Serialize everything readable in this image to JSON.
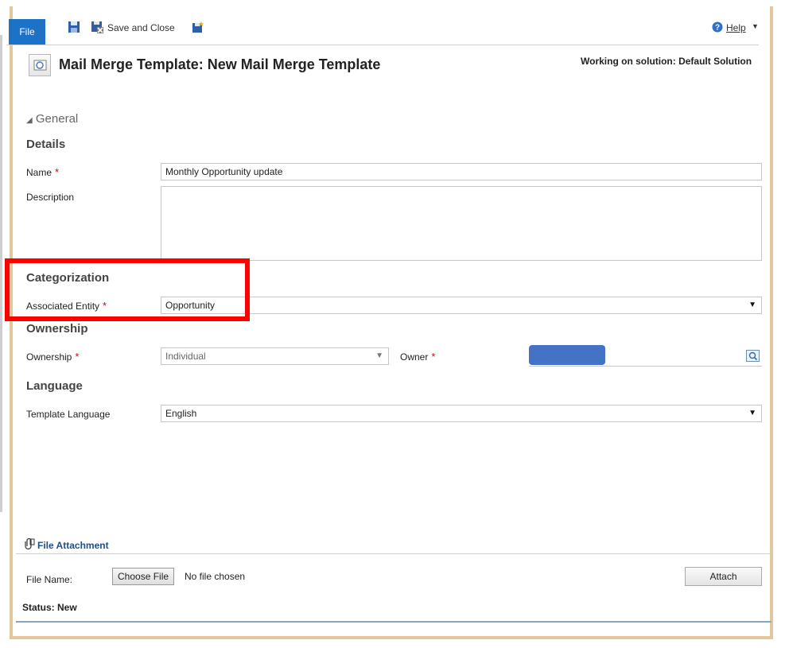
{
  "toolbar": {
    "file_label": "File",
    "save_and_close_label": "Save and Close",
    "help_label": "Help"
  },
  "header": {
    "title": "Mail Merge Template: New Mail Merge Template",
    "solution": "Working on solution: Default Solution"
  },
  "general": {
    "toggle_label": "General",
    "details_heading": "Details",
    "name_label": "Name",
    "name_value": "Monthly Opportunity update",
    "description_label": "Description",
    "description_value": "",
    "categorization_heading": "Categorization",
    "associated_entity_label": "Associated Entity",
    "associated_entity_value": "Opportunity",
    "ownership_heading": "Ownership",
    "ownership_label": "Ownership",
    "ownership_value": "Individual",
    "owner_label": "Owner",
    "language_heading": "Language",
    "template_language_label": "Template Language",
    "template_language_value": "English"
  },
  "attachment": {
    "title": "File Attachment",
    "file_name_label": "File Name:",
    "choose_file_label": "Choose File",
    "no_file_text": "No file chosen",
    "attach_label": "Attach"
  },
  "status": {
    "text": "Status: New"
  },
  "colors": {
    "file_tab": "#1e72c6",
    "required": "#d0021b",
    "highlight": "#ff0000",
    "frame": "#e2c79b",
    "redaction": "#4472c4"
  }
}
